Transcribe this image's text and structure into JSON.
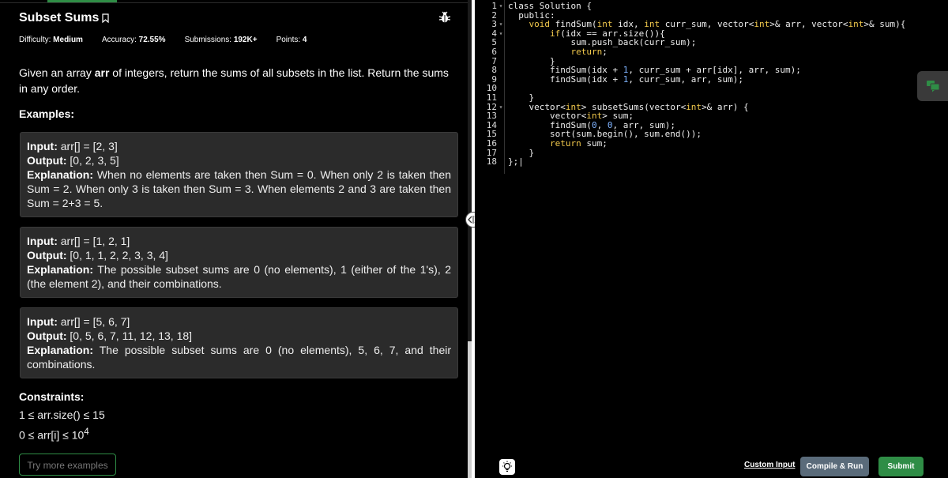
{
  "problem": {
    "title": "Subset Sums",
    "meta": {
      "difficulty_label": "Difficulty:",
      "difficulty": "Medium",
      "accuracy_label": "Accuracy:",
      "accuracy": "72.55%",
      "submissions_label": "Submissions:",
      "submissions": "192K+",
      "points_label": "Points:",
      "points": "4"
    },
    "description": {
      "before": "Given an array ",
      "var": "arr",
      "after": " of integers, return the sums of all subsets in the list.  Return the sums in any order."
    },
    "examples_heading": "Examples:",
    "examples": [
      {
        "input_label": "Input:",
        "input": " arr[] = [2, 3]",
        "output_label": "Output:",
        "output": " [0, 2, 3, 5]",
        "explanation_label": "Explanation:",
        "explanation": " When no elements are taken then Sum = 0. When only 2 is taken then Sum = 2. When only 3 is taken then Sum = 3. When elements 2 and 3 are taken then Sum = 2+3 = 5."
      },
      {
        "input_label": "Input:",
        "input": " arr[] = [1, 2, 1]",
        "output_label": "Output:",
        "output": " [0, 1, 1, 2, 2, 3, 3, 4]",
        "explanation_label": "Explanation:",
        "explanation": " The possible subset sums are 0 (no elements), 1 (either of the 1's), 2 (the element 2), and their combinations."
      },
      {
        "input_label": "Input:",
        "input": " arr[] = [5, 6, 7]",
        "output_label": "Output:",
        "output": " [0, 5, 6, 7, 11, 12, 13, 18]",
        "explanation_label": "Explanation:",
        "explanation": " The possible subset sums are 0 (no elements), 5, 6, 7, and their combinations."
      }
    ],
    "constraints_heading": "Constraints:",
    "constraints": [
      {
        "left": "1 ≤ arr.size() ≤ 15",
        "sup": ""
      },
      {
        "left": "0 ≤ arr[i] ≤ 10",
        "sup": "4"
      }
    ],
    "try_more": "Try more examples"
  },
  "editor": {
    "line_numbers": [
      "1",
      "2",
      "3",
      "4",
      "5",
      "6",
      "7",
      "8",
      "9",
      "10",
      "11",
      "12",
      "13",
      "14",
      "15",
      "16",
      "17",
      "18"
    ],
    "fold_lines": [
      1,
      3,
      4,
      12
    ],
    "code_lines": [
      "class Solution {",
      "  public:",
      "    void findSum(int idx, int curr_sum, vector<int>& arr, vector<int>& sum){",
      "        if(idx == arr.size()){",
      "            sum.push_back(curr_sum);",
      "            return;",
      "        }",
      "        findSum(idx + 1, curr_sum + arr[idx], arr, sum);",
      "        findSum(idx + 1, curr_sum, arr, sum);",
      "",
      "    }",
      "    vector<int> subsetSums(vector<int>& arr) {",
      "        vector<int> sum;",
      "        findSum(0, 0, arr, sum);",
      "        sort(sum.begin(), sum.end());",
      "        return sum;",
      "    }",
      "};|"
    ]
  },
  "actions": {
    "custom_input": "Custom Input",
    "compile_run": "Compile & Run",
    "submit": "Submit"
  },
  "colors": {
    "accent_green": "#2f8d46",
    "compile_gray": "#5a6b7a",
    "example_bg": "#2b2b2b"
  },
  "icons": {
    "bookmark": "bookmark-icon",
    "bug": "bug-icon",
    "split": "split-handle-icon",
    "chat": "chat-icon",
    "bulb": "lightbulb-icon"
  }
}
